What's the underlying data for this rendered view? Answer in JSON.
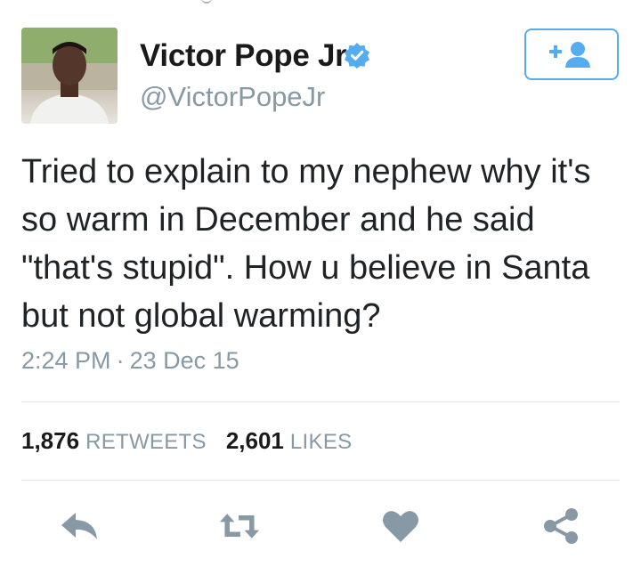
{
  "user": {
    "display_name": "Victor Pope Jr",
    "handle": "@VictorPopeJr",
    "verified": true
  },
  "follow_button": {
    "icon": "add-user-icon"
  },
  "tweet": {
    "text": "Tried to explain to my nephew why it's so warm in December and he said \"that's stupid\". How u believe in Santa but not global warming?",
    "time": "2:24 PM",
    "separator": "·",
    "date": "23 Dec 15"
  },
  "stats": {
    "retweets_count": "1,876",
    "retweets_label": "RETWEETS",
    "likes_count": "2,601",
    "likes_label": "LIKES"
  },
  "actions": [
    {
      "name": "reply",
      "icon": "reply-icon"
    },
    {
      "name": "retweet",
      "icon": "retweet-icon"
    },
    {
      "name": "like",
      "icon": "heart-icon"
    },
    {
      "name": "share",
      "icon": "share-icon"
    }
  ],
  "colors": {
    "accent": "#55acee",
    "icon_gray": "#8899a6",
    "divider": "#e1e8ed",
    "text": "#1f2326"
  }
}
